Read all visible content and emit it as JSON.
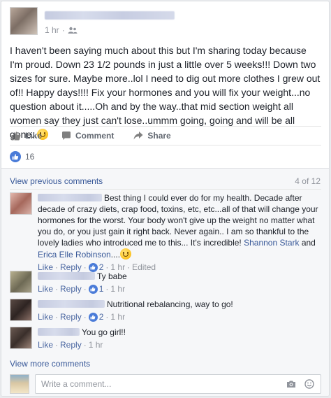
{
  "post": {
    "time": "1 hr",
    "text": "I haven't been saying much about this but I'm sharing today because I'm proud. Down 23 1/2 pounds in just a little over 5 weeks!!! Down two sizes for sure. Maybe more..lol I need to dig out more clothes I grew out of!! Happy days!!!! Fix your hormones and you will fix your weight...no question about it.....Oh and by the way..that mid section weight all women say they just can't lose..ummm going, going and will be all gone..",
    "actions": {
      "like": "Like",
      "comment": "Comment",
      "share": "Share"
    },
    "reaction_count": "16"
  },
  "comments_panel": {
    "view_previous": "View previous comments",
    "count": "4 of 12",
    "view_more": "View more comments",
    "composer_placeholder": "Write a comment...",
    "like_label": "Like",
    "reply_label": "Reply"
  },
  "comments": [
    {
      "text": "Best thing I could ever do for my health. Decade after decade of crazy diets, crap food, toxins, etc, etc...all of that will change your hormones for the worst. Your body won't give up the weight no matter what you do, or you just gain it right back. Never again.. I am so thankful to the lovely ladies who introduced me to this... It's incredible! ",
      "mention1": "Shannon Stark",
      "and": " and ",
      "mention2": "Erica Elle Robinson",
      "tail": "....",
      "likes": "2",
      "time": "1 hr",
      "edited": "Edited"
    },
    {
      "text": "Ty babe",
      "likes": "1",
      "time": "1 hr"
    },
    {
      "text": "Nutritional rebalancing, way to go!",
      "likes": "2",
      "time": "1 hr"
    },
    {
      "text": "You go girl!!",
      "time": "1 hr"
    }
  ],
  "colors": {
    "link": "#385898",
    "like_blue": "#4a7bd8",
    "panel_bg": "#f6f7f9"
  },
  "icons": [
    "friends-icon",
    "thumbs-up-icon",
    "comment-icon",
    "share-icon",
    "like-reaction-icon",
    "camera-icon",
    "emoji-icon",
    "smiley-emoji-icon"
  ]
}
